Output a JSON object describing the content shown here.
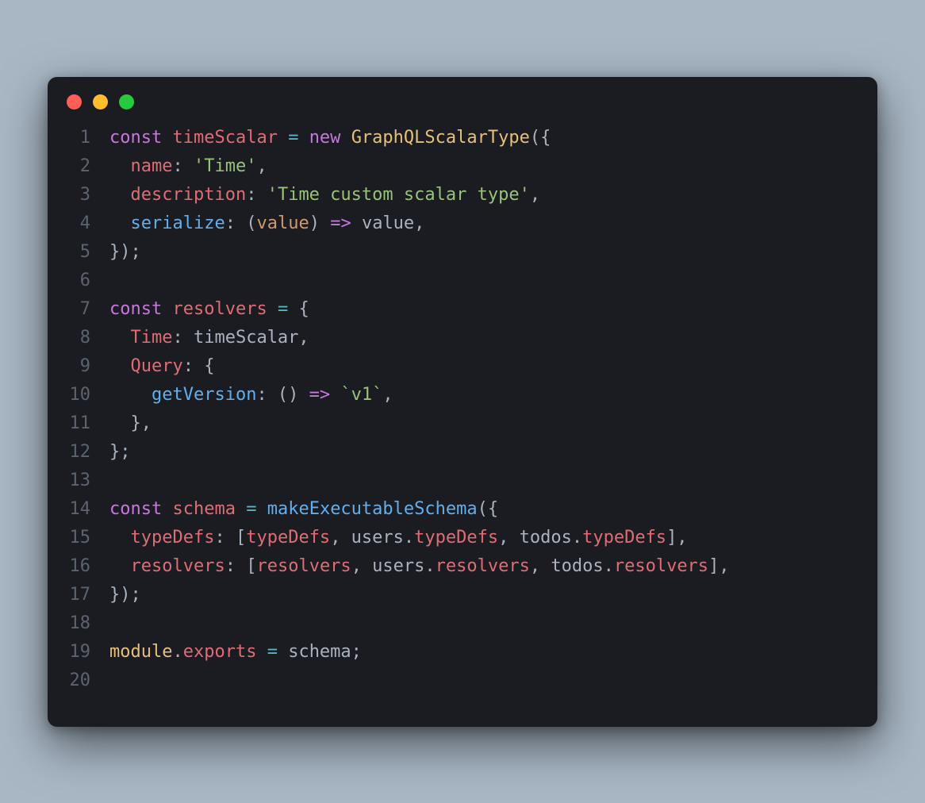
{
  "window": {
    "traffic_lights": [
      "close",
      "minimize",
      "zoom"
    ]
  },
  "code": {
    "lines": [
      {
        "n": "1",
        "tokens": [
          {
            "c": "kw",
            "t": "const"
          },
          {
            "c": "pl",
            "t": " "
          },
          {
            "c": "ident",
            "t": "timeScalar"
          },
          {
            "c": "pl",
            "t": " "
          },
          {
            "c": "op",
            "t": "="
          },
          {
            "c": "pl",
            "t": " "
          },
          {
            "c": "kw",
            "t": "new"
          },
          {
            "c": "pl",
            "t": " "
          },
          {
            "c": "cls",
            "t": "GraphQLScalarType"
          },
          {
            "c": "pl",
            "t": "({"
          }
        ]
      },
      {
        "n": "2",
        "tokens": [
          {
            "c": "pl",
            "t": "  "
          },
          {
            "c": "ident",
            "t": "name"
          },
          {
            "c": "pl",
            "t": ": "
          },
          {
            "c": "str",
            "t": "'Time'"
          },
          {
            "c": "pl",
            "t": ","
          }
        ]
      },
      {
        "n": "3",
        "tokens": [
          {
            "c": "pl",
            "t": "  "
          },
          {
            "c": "ident",
            "t": "description"
          },
          {
            "c": "pl",
            "t": ": "
          },
          {
            "c": "str",
            "t": "'Time custom scalar type'"
          },
          {
            "c": "pl",
            "t": ","
          }
        ]
      },
      {
        "n": "4",
        "tokens": [
          {
            "c": "pl",
            "t": "  "
          },
          {
            "c": "fn",
            "t": "serialize"
          },
          {
            "c": "pl",
            "t": ": ("
          },
          {
            "c": "param",
            "t": "value"
          },
          {
            "c": "pl",
            "t": ") "
          },
          {
            "c": "kw",
            "t": "=>"
          },
          {
            "c": "pl",
            "t": " value,"
          }
        ]
      },
      {
        "n": "5",
        "tokens": [
          {
            "c": "pl",
            "t": "});"
          }
        ]
      },
      {
        "n": "6",
        "tokens": []
      },
      {
        "n": "7",
        "tokens": [
          {
            "c": "kw",
            "t": "const"
          },
          {
            "c": "pl",
            "t": " "
          },
          {
            "c": "ident",
            "t": "resolvers"
          },
          {
            "c": "pl",
            "t": " "
          },
          {
            "c": "op",
            "t": "="
          },
          {
            "c": "pl",
            "t": " {"
          }
        ]
      },
      {
        "n": "8",
        "tokens": [
          {
            "c": "pl",
            "t": "  "
          },
          {
            "c": "ident",
            "t": "Time"
          },
          {
            "c": "pl",
            "t": ": timeScalar,"
          }
        ]
      },
      {
        "n": "9",
        "tokens": [
          {
            "c": "pl",
            "t": "  "
          },
          {
            "c": "ident",
            "t": "Query"
          },
          {
            "c": "pl",
            "t": ": {"
          }
        ]
      },
      {
        "n": "10",
        "tokens": [
          {
            "c": "pl",
            "t": "    "
          },
          {
            "c": "fn",
            "t": "getVersion"
          },
          {
            "c": "pl",
            "t": ": () "
          },
          {
            "c": "kw",
            "t": "=>"
          },
          {
            "c": "pl",
            "t": " "
          },
          {
            "c": "str",
            "t": "`v1`"
          },
          {
            "c": "pl",
            "t": ","
          }
        ]
      },
      {
        "n": "11",
        "tokens": [
          {
            "c": "pl",
            "t": "  },"
          }
        ]
      },
      {
        "n": "12",
        "tokens": [
          {
            "c": "pl",
            "t": "};"
          }
        ]
      },
      {
        "n": "13",
        "tokens": []
      },
      {
        "n": "14",
        "tokens": [
          {
            "c": "kw",
            "t": "const"
          },
          {
            "c": "pl",
            "t": " "
          },
          {
            "c": "ident",
            "t": "schema"
          },
          {
            "c": "pl",
            "t": " "
          },
          {
            "c": "op",
            "t": "="
          },
          {
            "c": "pl",
            "t": " "
          },
          {
            "c": "fn",
            "t": "makeExecutableSchema"
          },
          {
            "c": "pl",
            "t": "({"
          }
        ]
      },
      {
        "n": "15",
        "tokens": [
          {
            "c": "pl",
            "t": "  "
          },
          {
            "c": "ident",
            "t": "typeDefs"
          },
          {
            "c": "pl",
            "t": ": ["
          },
          {
            "c": "ident",
            "t": "typeDefs"
          },
          {
            "c": "pl",
            "t": ", users."
          },
          {
            "c": "ident",
            "t": "typeDefs"
          },
          {
            "c": "pl",
            "t": ", todos."
          },
          {
            "c": "ident",
            "t": "typeDefs"
          },
          {
            "c": "pl",
            "t": "],"
          }
        ]
      },
      {
        "n": "16",
        "tokens": [
          {
            "c": "pl",
            "t": "  "
          },
          {
            "c": "ident",
            "t": "resolvers"
          },
          {
            "c": "pl",
            "t": ": ["
          },
          {
            "c": "ident",
            "t": "resolvers"
          },
          {
            "c": "pl",
            "t": ", users."
          },
          {
            "c": "ident",
            "t": "resolvers"
          },
          {
            "c": "pl",
            "t": ", todos."
          },
          {
            "c": "ident",
            "t": "resolvers"
          },
          {
            "c": "pl",
            "t": "],"
          }
        ]
      },
      {
        "n": "17",
        "tokens": [
          {
            "c": "pl",
            "t": "});"
          }
        ]
      },
      {
        "n": "18",
        "tokens": []
      },
      {
        "n": "19",
        "tokens": [
          {
            "c": "cls",
            "t": "module"
          },
          {
            "c": "pl",
            "t": "."
          },
          {
            "c": "ident",
            "t": "exports"
          },
          {
            "c": "pl",
            "t": " "
          },
          {
            "c": "op",
            "t": "="
          },
          {
            "c": "pl",
            "t": " schema;"
          }
        ]
      },
      {
        "n": "20",
        "tokens": []
      }
    ]
  }
}
